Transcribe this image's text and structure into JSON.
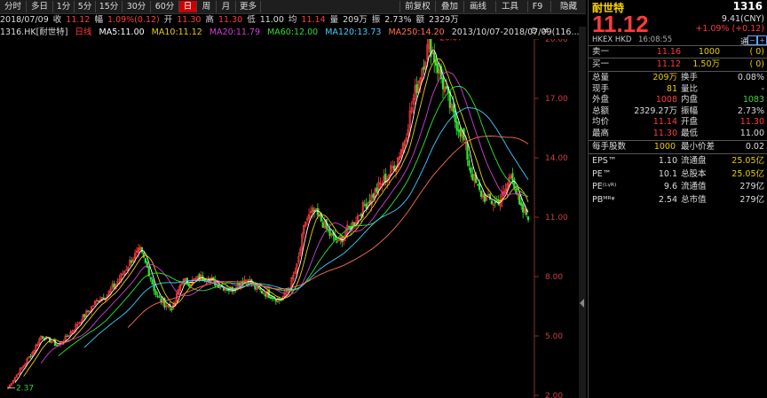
{
  "toolbar": {
    "tabs": [
      "分时",
      "多日",
      "1分",
      "5分",
      "15分",
      "30分",
      "60分",
      "日",
      "周",
      "月",
      "更多"
    ],
    "active_tab": "日",
    "right_tabs": [
      "前复权",
      "叠加",
      "画线",
      "工具",
      "F9",
      "隐藏"
    ]
  },
  "info": {
    "date": "2018/07/09",
    "close_label": "收",
    "close": "11.12",
    "change_label": "幅",
    "change": "1.09%(0.12)",
    "open_label": "开",
    "open": "11.30",
    "high_label": "高",
    "high": "11.30",
    "low_label": "低",
    "low": "11.00",
    "avg_label": "均",
    "avg": "11.14",
    "volume_label": "量",
    "volume": "209万",
    "turnover_label": "振",
    "turnover": "2.73%",
    "amount_label": "额",
    "amount": "2329万"
  },
  "ma_strip": {
    "code": "1316.HK",
    "name_tag": "[耐世特]",
    "line_type": "日线",
    "ma5": "MA5:11.00",
    "ma10": "MA10:11.12",
    "ma20": "MA20:11.79",
    "ma60": "MA60:12.00",
    "ma120": "MA120:13.73",
    "ma250": "MA250:14.20",
    "range": "2013/10/07-2018/07/09(116..."
  },
  "chart_data": {
    "type": "candlestick",
    "y_ticks": [
      "20.00",
      "17.00",
      "14.00",
      "11.00",
      "8.00",
      "5.00",
      "2.00"
    ],
    "ylim": [
      2,
      20
    ],
    "high_marker": "20.07",
    "low_marker": "2.37",
    "close_series": [
      2.4,
      3.0,
      3.6,
      4.2,
      5.0,
      4.8,
      4.5,
      4.9,
      5.4,
      5.9,
      6.4,
      6.9,
      7.1,
      7.6,
      8.2,
      8.9,
      9.3,
      8.3,
      7.0,
      6.6,
      6.4,
      7.8,
      7.7,
      7.9,
      8.0,
      7.7,
      7.5,
      7.3,
      7.7,
      7.9,
      7.4,
      7.2,
      7.0,
      6.8,
      7.4,
      8.5,
      10.8,
      11.3,
      10.8,
      10.1,
      9.7,
      10.3,
      10.8,
      11.5,
      12.0,
      12.6,
      13.1,
      13.8,
      14.9,
      16.8,
      18.4,
      19.8,
      18.6,
      17.3,
      16.0,
      15.2,
      13.4,
      12.3,
      11.9,
      11.7,
      12.1,
      13.3,
      11.4,
      11.1
    ],
    "colors": {
      "up": "#ff3b3b",
      "down": "#2ee82e",
      "ma5": "#ffffff",
      "ma10": "#e8d000",
      "ma20": "#d040d0",
      "ma60": "#2ee82e",
      "ma120": "#40d0ff",
      "ma250": "#ff7050"
    }
  },
  "panel": {
    "name": "耐世特",
    "code": "1316",
    "price": "11.12",
    "cny": "9.41(CNY)",
    "change": "+1.09% (+0.12)",
    "exchange": "HKEX HKD",
    "time": "16:08:55",
    "tong": "通",
    "ask_label": "卖一",
    "ask_price": "11.16",
    "ask_vol": "1000",
    "ask_cnt": "( 0)",
    "bid_label": "买一",
    "bid_price": "11.12",
    "bid_vol": "1.50万",
    "bid_cnt": "( 0)",
    "stats": [
      {
        "l1": "总量",
        "v1": "209万",
        "c1": "yellow",
        "l2": "换手",
        "v2": "0.08%",
        "c2": "white"
      },
      {
        "l1": "现手",
        "v1": "81",
        "c1": "yellow",
        "l2": "量比",
        "v2": "-",
        "c2": "white"
      },
      {
        "l1": "外盘",
        "v1": "1008",
        "c1": "red",
        "l2": "内盘",
        "v2": "1083",
        "c2": "green"
      },
      {
        "l1": "总额",
        "v1": "2329.27万",
        "c1": "white",
        "l2": "振幅",
        "v2": "2.73%",
        "c2": "white"
      },
      {
        "l1": "均价",
        "v1": "11.14",
        "c1": "red",
        "l2": "开盘",
        "v2": "11.30",
        "c2": "red"
      },
      {
        "l1": "最高",
        "v1": "11.30",
        "c1": "red",
        "l2": "最低",
        "v2": "11.00",
        "c2": "white"
      }
    ],
    "lot_label": "每手股数",
    "lot_value": "1000",
    "tick_label": "最小价差",
    "tick_value": "0.02",
    "fund": [
      {
        "l1": "EPS™",
        "v1": "1.10",
        "l2": "流通盘",
        "v2": "25.05亿",
        "c2": "yellow"
      },
      {
        "l1": "PE™",
        "v1": "10.1",
        "l2": "总股本",
        "v2": "25.05亿",
        "c2": "yellow"
      },
      {
        "l1": "PE⁽ᴸᵞᴿ⁾",
        "v1": "9.6",
        "l2": "流通值",
        "v2": "279亿",
        "c2": "white"
      },
      {
        "l1": "PBᴹᴿᵠ",
        "v1": "2.54",
        "l2": "总市值",
        "v2": "279亿",
        "c2": "white"
      }
    ]
  }
}
